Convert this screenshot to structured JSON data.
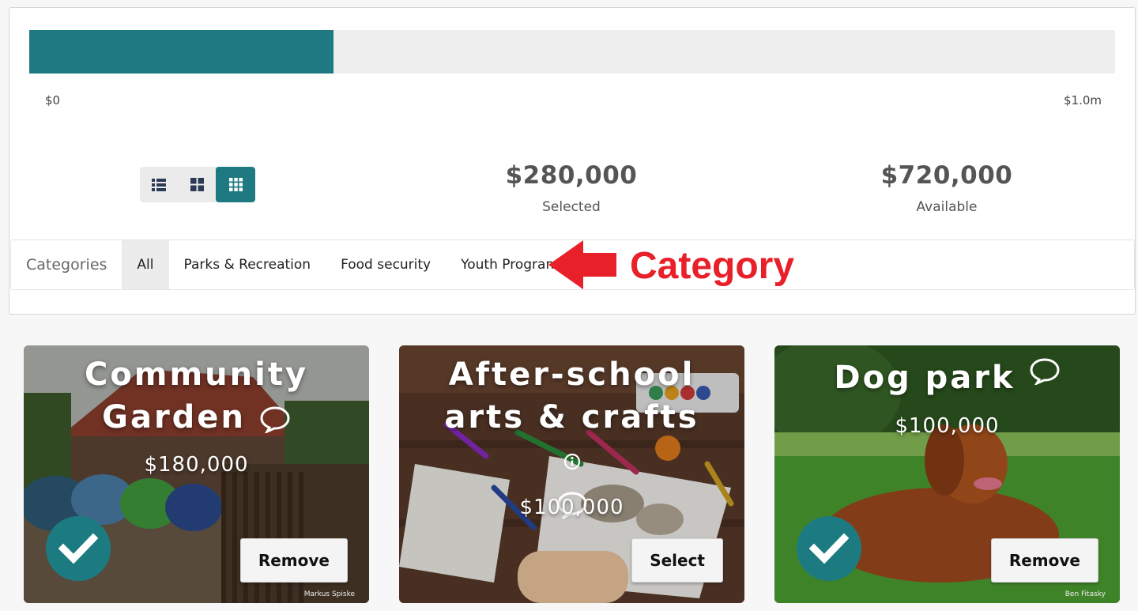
{
  "budget": {
    "min_label": "$0",
    "max_label": "$1.0m",
    "selected_fraction": 0.28,
    "bar_color": "#1e7a80",
    "selected_value": "$280,000",
    "selected_label": "Selected",
    "available_value": "$720,000",
    "available_label": "Available"
  },
  "view_modes": [
    {
      "icon": "list-view-icon",
      "active": false
    },
    {
      "icon": "grid-large-icon",
      "active": false
    },
    {
      "icon": "grid-small-icon",
      "active": true
    }
  ],
  "categories": {
    "title": "Categories",
    "items": [
      {
        "label": "All",
        "active": true
      },
      {
        "label": "Parks & Recreation",
        "active": false
      },
      {
        "label": "Food security",
        "active": false
      },
      {
        "label": "Youth Programs",
        "active": false
      }
    ]
  },
  "annotation": {
    "text": "Category",
    "color": "#e8202a"
  },
  "projects": [
    {
      "title": "Community Garden",
      "price": "$180,000",
      "action": "Remove",
      "selected": true,
      "credit": "Markus Spiske",
      "icons": [
        "comment-icon"
      ]
    },
    {
      "title": "After-school arts & crafts",
      "price": "$100,000",
      "action": "Select",
      "selected": false,
      "credit": "",
      "icons": [
        "info-icon",
        "comment-icon"
      ]
    },
    {
      "title": "Dog park",
      "price": "$100,000",
      "action": "Remove",
      "selected": true,
      "credit": "Ben Fitasky",
      "icons": [
        "comment-icon"
      ]
    }
  ]
}
